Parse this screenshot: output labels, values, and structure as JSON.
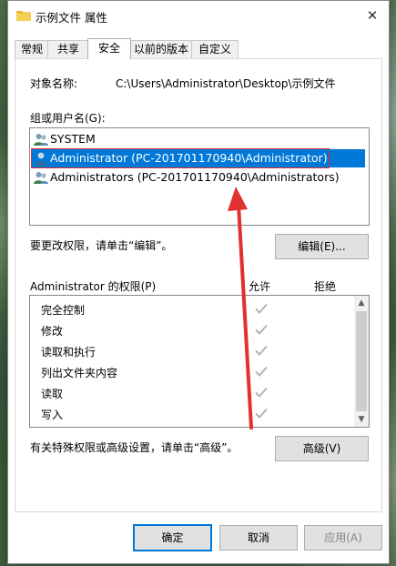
{
  "window": {
    "title": "示例文件 属性",
    "close_icon": "close-icon"
  },
  "tabs": [
    {
      "label": "常规"
    },
    {
      "label": "共享"
    },
    {
      "label": "安全",
      "active": true
    },
    {
      "label": "以前的版本"
    },
    {
      "label": "自定义"
    }
  ],
  "security": {
    "object_name_label": "对象名称:",
    "object_name_value": "C:\\Users\\Administrator\\Desktop\\示例文件",
    "group_label": "组或用户名(G):",
    "users": [
      {
        "name": "SYSTEM",
        "icon": "user-group-icon"
      },
      {
        "name": "Administrator (PC-201701170940\\Administrator)",
        "icon": "user-icon",
        "selected": true
      },
      {
        "name": "Administrators (PC-201701170940\\Administrators)",
        "icon": "user-group-icon"
      }
    ],
    "change_hint": "要更改权限，请单击“编辑”。",
    "edit_button": "编辑(E)...",
    "perm_header": "Administrator 的权限(P)",
    "allow_header": "允许",
    "deny_header": "拒绝",
    "permissions": [
      {
        "name": "完全控制",
        "allow": true
      },
      {
        "name": "修改",
        "allow": true
      },
      {
        "name": "读取和执行",
        "allow": true
      },
      {
        "name": "列出文件夹内容",
        "allow": true
      },
      {
        "name": "读取",
        "allow": true
      },
      {
        "name": "写入",
        "allow": true
      }
    ],
    "advanced_hint": "有关特殊权限或高级设置，请单击“高级”。",
    "advanced_button": "高级(V)"
  },
  "footer": {
    "ok": "确定",
    "cancel": "取消",
    "apply": "应用(A)"
  },
  "colors": {
    "selection": "#0078d7",
    "annotation": "#e03030"
  }
}
